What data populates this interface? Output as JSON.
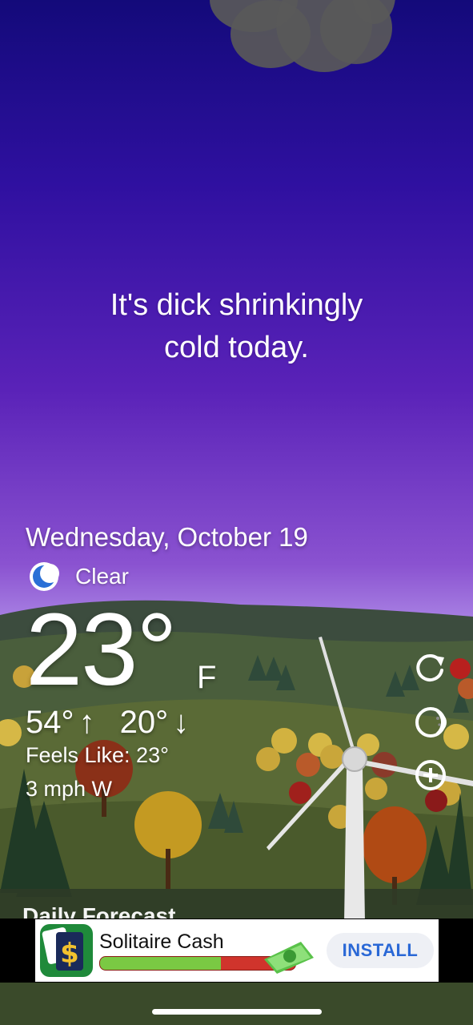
{
  "quote": {
    "line1": "It's dick shrinkingly",
    "line2": "cold today."
  },
  "weather": {
    "date": "Wednesday, October 19",
    "condition_icon": "moon-icon",
    "condition": "Clear",
    "temperature": "23°",
    "unit": "F",
    "high": "54°",
    "high_arrow": "↑",
    "low": "20°",
    "low_arrow": "↓",
    "feels_like": "Feels Like: 23°",
    "wind": "3 mph W"
  },
  "actions": {
    "refresh_icon": "refresh-icon",
    "theme_icon": "moon-phase-icon",
    "add_icon": "add-location-icon"
  },
  "ad": {
    "app_name": "Solitaire Cash",
    "progress": 0.62,
    "install_label": "INSTALL",
    "accent_color": "#2a68d6"
  },
  "peek": {
    "section_title": "Daily Forecast"
  }
}
